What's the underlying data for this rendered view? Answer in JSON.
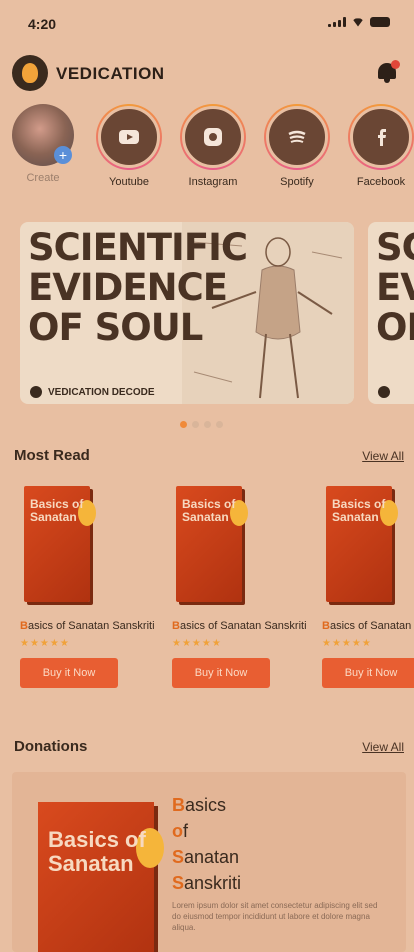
{
  "status": {
    "time": "4:20"
  },
  "brand": {
    "name": "VEDICATION"
  },
  "stories": [
    {
      "label": "Create",
      "icon": "profile-avatar"
    },
    {
      "label": "Youtube",
      "icon": "youtube-icon"
    },
    {
      "label": "Instagram",
      "icon": "instagram-icon"
    },
    {
      "label": "Spotify",
      "icon": "spotify-icon"
    },
    {
      "label": "Facebook",
      "icon": "facebook-icon"
    }
  ],
  "banner": {
    "title": "SCIENTIFIC\nEVIDENCE\nOF SOUL",
    "footer": "VEDICATION DECODE",
    "next_title": "SC\nEV\nOF",
    "slides": 4,
    "active_slide": 1
  },
  "most_read": {
    "title": "Most Read",
    "view_all": "View All",
    "books": [
      {
        "title_prefix": "B",
        "title": "asics of Sanatan Sanskriti",
        "title_parts": [
          "Basics",
          "of",
          "Sanatan",
          "Sanskriti"
        ],
        "cover_text": "Basics\nof\nSanatan",
        "rating": 5,
        "button": "Buy it Now"
      },
      {
        "title_prefix": "B",
        "title": "asics of Sanatan Sanskriti",
        "title_parts": [
          "Basics",
          "of",
          "Sanatan",
          "Sanskriti"
        ],
        "cover_text": "Basics\nof\nSanatan",
        "rating": 5,
        "button": "Buy it Now"
      },
      {
        "title_prefix": "B",
        "title": "asics of Sanatan Sanskriti",
        "title_parts": [
          "Basics",
          "of",
          "Sanatan",
          "Sanskriti"
        ],
        "cover_text": "Basics\nof\nSanatan",
        "rating": 5,
        "button": "Buy it Now"
      }
    ]
  },
  "donations": {
    "title": "Donations",
    "view_all": "View All",
    "book": {
      "title_lines": [
        "Basics",
        "of",
        "Sanatan",
        "Sanskriti"
      ],
      "cover_text": "Basics\nof\nSanatan",
      "description": "Lorem ipsum dolor sit amet consectetur adipiscing elit sed do eiusmod tempor incididunt ut labore et dolore magna aliqua."
    }
  },
  "colors": {
    "background": "#e8bfa2",
    "accent": "#e85e32",
    "brand_dark": "#3a2a1e",
    "star": "#f0a23a"
  }
}
